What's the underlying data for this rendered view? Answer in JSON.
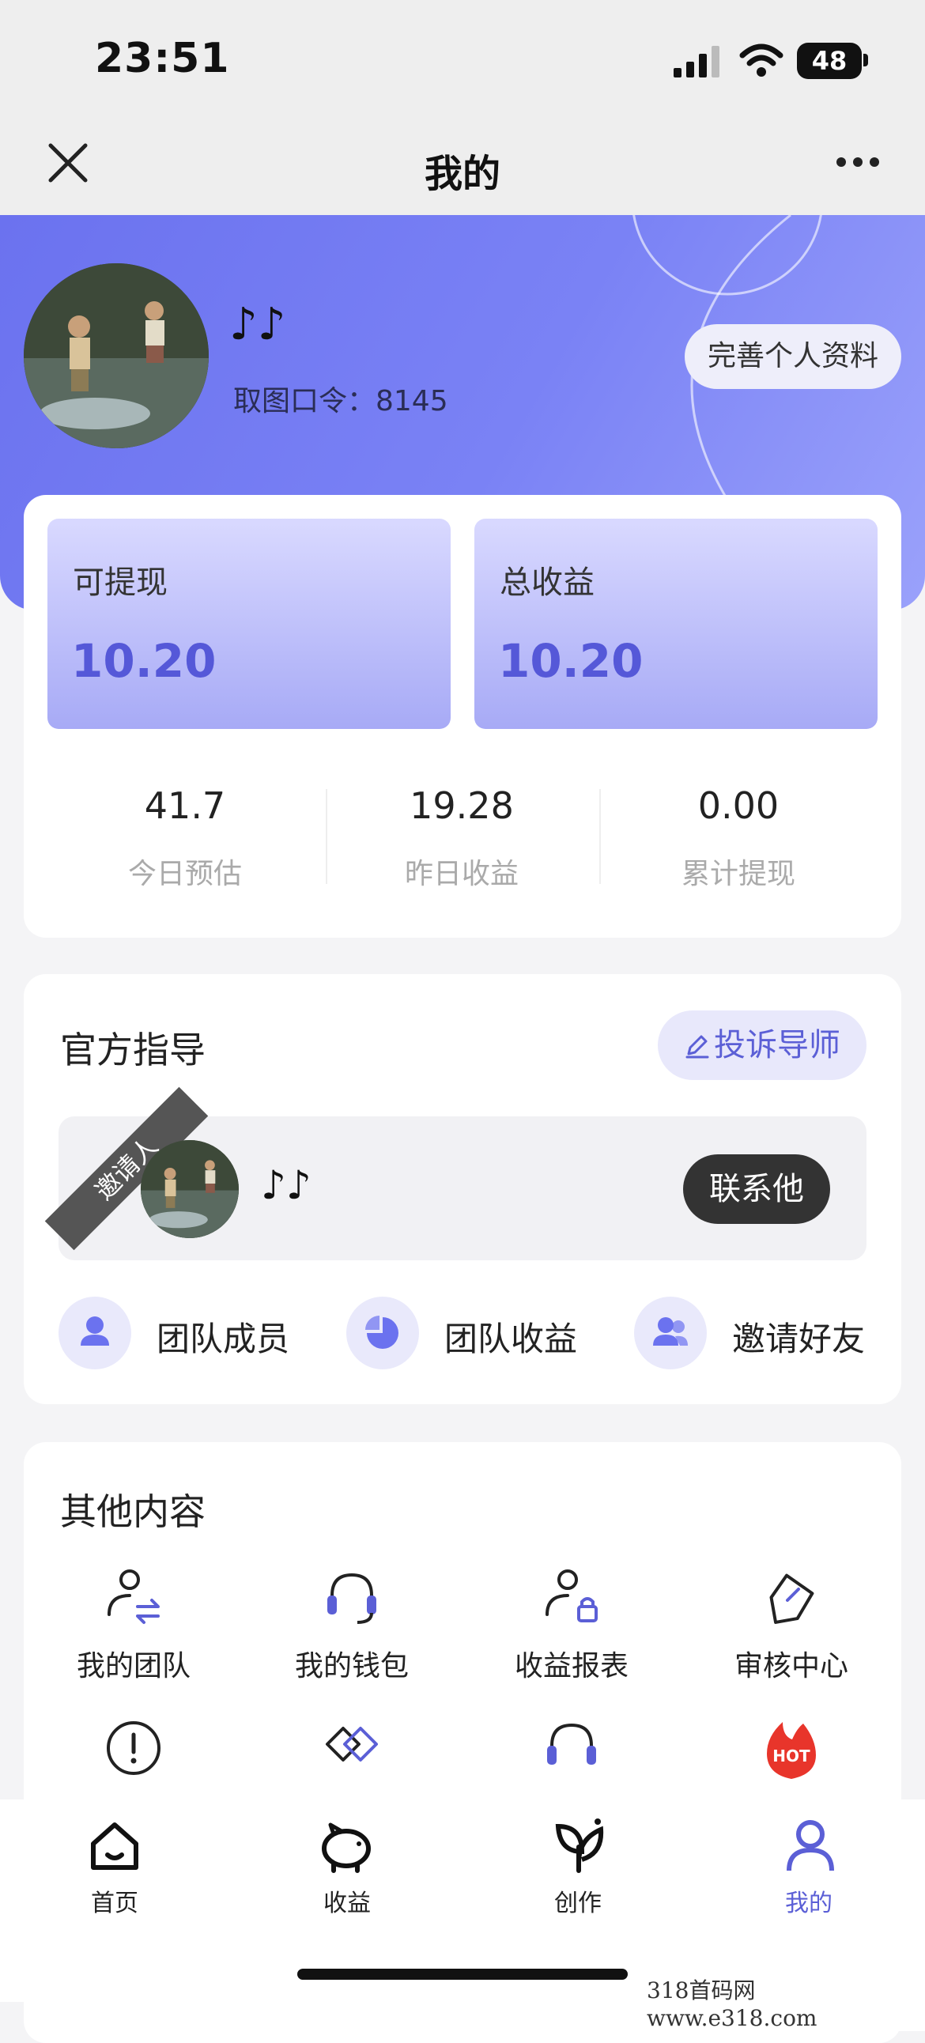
{
  "status_bar": {
    "time": "23:51",
    "battery": "48"
  },
  "nav": {
    "title": "我的",
    "close_icon": "close-icon",
    "more_icon": "more-icon"
  },
  "profile": {
    "nickname": "♪♪",
    "code_label": "取图口令：8145",
    "edit_button": "完善个人资料"
  },
  "wallet": {
    "withdrawable_label": "可提现",
    "withdrawable_value": "10.20",
    "total_label": "总收益",
    "total_value": "10.20",
    "stats": [
      {
        "value": "41.7",
        "label": "今日预估"
      },
      {
        "value": "19.28",
        "label": "昨日收益"
      },
      {
        "value": "0.00",
        "label": "累计提现"
      }
    ]
  },
  "guidance": {
    "title": "官方指导",
    "complain_button": "投诉导师",
    "ribbon": "邀请人",
    "inviter_name": "♪♪",
    "contact_button": "联系他",
    "actions": [
      {
        "label": "团队成员",
        "icon": "person-icon"
      },
      {
        "label": "团队收益",
        "icon": "pie-chart-icon"
      },
      {
        "label": "邀请好友",
        "icon": "people-icon"
      }
    ]
  },
  "other": {
    "title": "其他内容",
    "items": [
      {
        "label": "我的团队",
        "icon": "team-switch-icon"
      },
      {
        "label": "我的钱包",
        "icon": "headset-icon"
      },
      {
        "label": "收益报表",
        "icon": "user-lock-icon"
      },
      {
        "label": "审核中心",
        "icon": "tag-icon"
      }
    ]
  },
  "tabbar": {
    "items": [
      {
        "label": "首页",
        "icon": "home-icon"
      },
      {
        "label": "收益",
        "icon": "piggy-bank-icon"
      },
      {
        "label": "创作",
        "icon": "leaf-icon"
      },
      {
        "label": "我的",
        "icon": "user-icon",
        "active": true
      }
    ],
    "active_color": "#5b5fd6"
  },
  "watermark": "318首码网 www.e318.com",
  "colors": {
    "accent": "#6b72ef",
    "value": "#5558d8"
  }
}
